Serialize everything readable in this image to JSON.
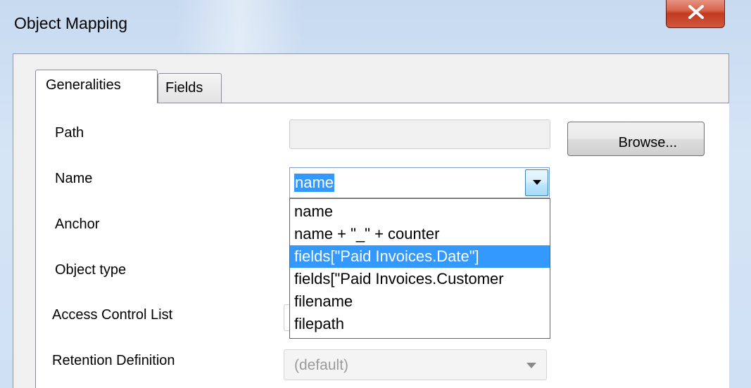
{
  "window": {
    "title": "Object Mapping"
  },
  "tabs": [
    {
      "label": "Generalities",
      "active": true
    },
    {
      "label": "Fields",
      "active": false
    }
  ],
  "form": {
    "path_label": "Path",
    "path_value": "",
    "browse_label": "Browse...",
    "name_label": "Name",
    "name_value": "name",
    "anchor_label": "Anchor",
    "object_type_label": "Object type",
    "acl_label": "Access Control List",
    "retention_label": "Retention Definition",
    "retention_value": "(default)"
  },
  "name_dropdown": {
    "options": [
      "name",
      "name + \"_\" + counter",
      "fields[\"Paid Invoices.Date\"]",
      "fields[\"Paid Invoices.Customer",
      "filename",
      "filepath"
    ],
    "highlighted_index": 2
  },
  "colors": {
    "selection": "#3399ff",
    "close_button": "#c94b32",
    "frame": "#cfe0f3"
  },
  "icons": {
    "close": "close-icon",
    "dropdown": "chevron-down-icon"
  }
}
